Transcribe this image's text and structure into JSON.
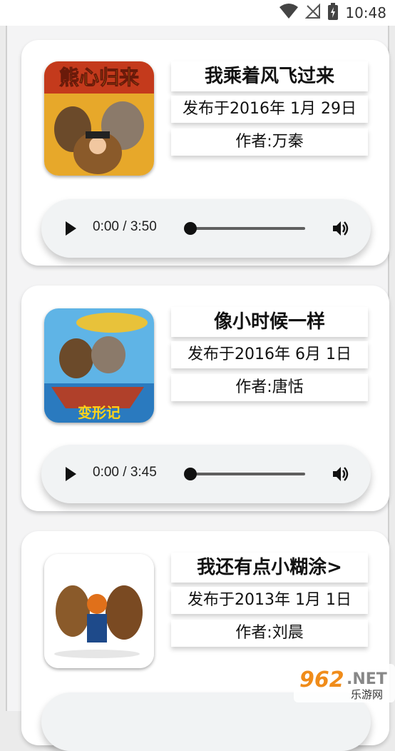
{
  "status_bar": {
    "time": "10:48"
  },
  "cards": [
    {
      "title": "我乘着风飞过来",
      "date": "发布于2016年 1月 29日",
      "author": "作者:万秦",
      "player_time": "0:00 / 3:50"
    },
    {
      "title": "像小时候一样",
      "date": "发布于2016年 6月 1日",
      "author": "作者:唐恬",
      "player_time": "0:00 / 3:45"
    },
    {
      "title": "我还有点小糊涂>",
      "date": "发布于2013年 1月 1日",
      "author": "作者:刘晨"
    }
  ],
  "watermark": {
    "number": "962",
    "tld": ".NET",
    "subtitle": "乐游网"
  }
}
